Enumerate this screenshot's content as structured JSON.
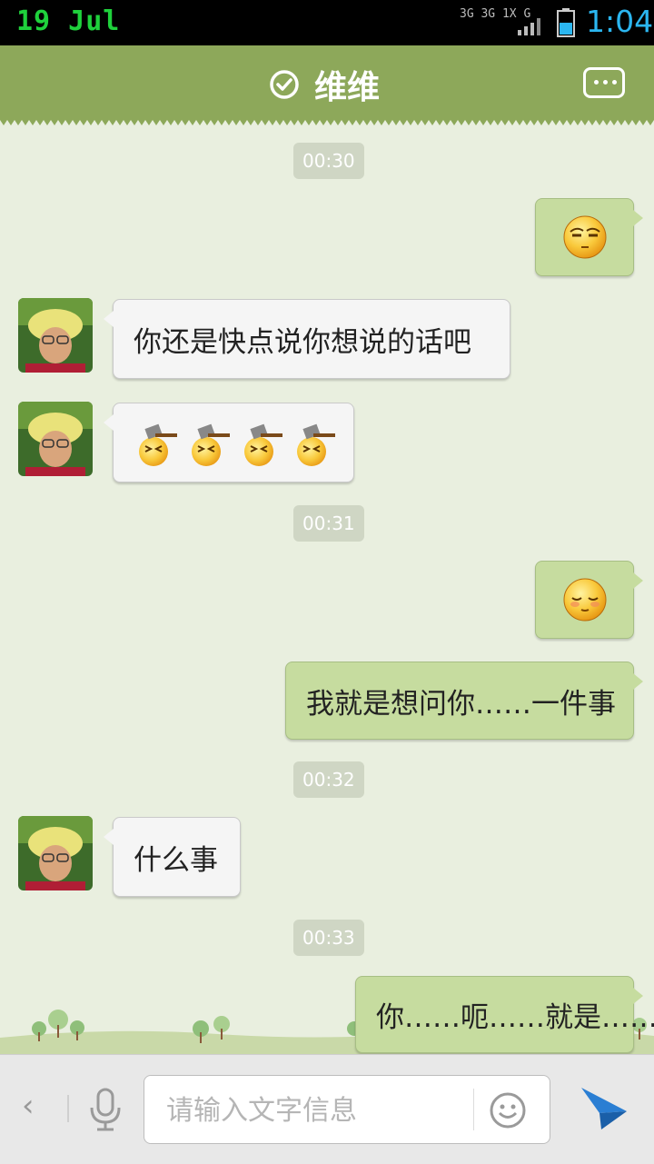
{
  "status_bar": {
    "date": "19 Jul",
    "network_labels": [
      "3G",
      "3G",
      "1X",
      "G"
    ],
    "time": "1:04",
    "battery_level": 0.5
  },
  "header": {
    "title": "维维",
    "verified_icon": "check-circle-icon",
    "menu_icon": "more-dots-icon"
  },
  "messages": [
    {
      "type": "time",
      "text": "00:30"
    },
    {
      "type": "outgoing",
      "kind": "emoji",
      "emoji": [
        "smug-face-emoji"
      ]
    },
    {
      "type": "incoming",
      "kind": "text",
      "text": "你还是快点说你想说的话吧"
    },
    {
      "type": "incoming",
      "kind": "emoji",
      "emoji": [
        "hammer-face-emoji",
        "hammer-face-emoji",
        "hammer-face-emoji",
        "hammer-face-emoji"
      ]
    },
    {
      "type": "time",
      "text": "00:31"
    },
    {
      "type": "outgoing",
      "kind": "emoji",
      "emoji": [
        "shy-face-emoji"
      ]
    },
    {
      "type": "outgoing",
      "kind": "text",
      "text": "我就是想问你……一件事"
    },
    {
      "type": "time",
      "text": "00:32"
    },
    {
      "type": "incoming",
      "kind": "text",
      "text": "什么事"
    },
    {
      "type": "time",
      "text": "00:33"
    },
    {
      "type": "outgoing",
      "kind": "text",
      "text": "你……呃……就是……"
    }
  ],
  "input_bar": {
    "placeholder": "请输入文字信息",
    "value": "",
    "icons": [
      "back-chevron-icon",
      "microphone-icon",
      "smiley-icon",
      "send-arrow-icon"
    ]
  },
  "colors": {
    "header": "#8da85a",
    "chat_background": "#e9efdf",
    "outgoing_bubble": "#c6dc9f",
    "incoming_bubble": "#f5f5f5",
    "status_date": "#1fd13c",
    "status_time": "#2bb6f0"
  }
}
